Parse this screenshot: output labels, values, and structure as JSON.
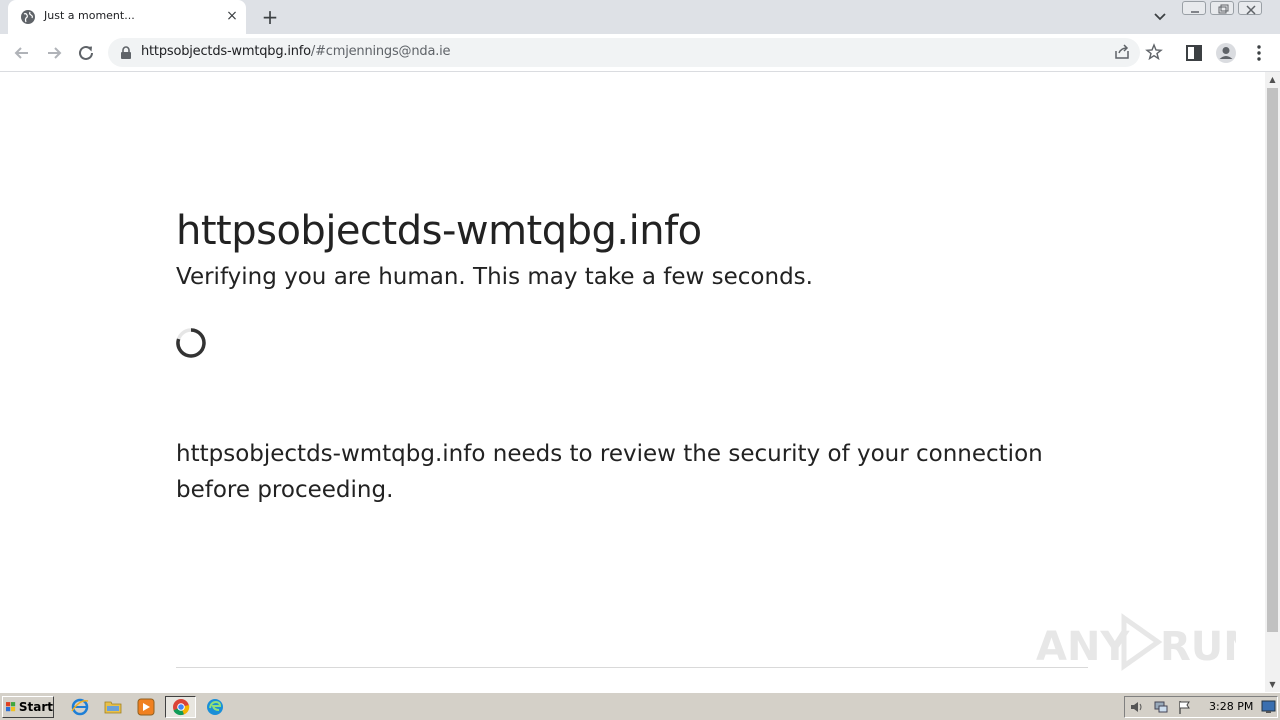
{
  "browser": {
    "tab_title": "Just a moment...",
    "tab_close": "×",
    "new_tab": "+",
    "url_host": "httpsobjectds-wmtqbg.info",
    "url_rest": "/#cmjennings@nda.ie"
  },
  "page": {
    "heading": "httpsobjectds-wmtqbg.info",
    "subheading": "Verifying you are human. This may take a few seconds.",
    "paragraph": "httpsobjectds-wmtqbg.info needs to review the security of your connection before proceeding."
  },
  "watermark": {
    "text_left": "ANY",
    "text_right": "RUN"
  },
  "taskbar": {
    "start_label": "Start",
    "clock": "3:28 PM"
  },
  "colors": {
    "text": "#222222",
    "tabstrip": "#dee1e6",
    "omnibox": "#f1f3f4"
  }
}
